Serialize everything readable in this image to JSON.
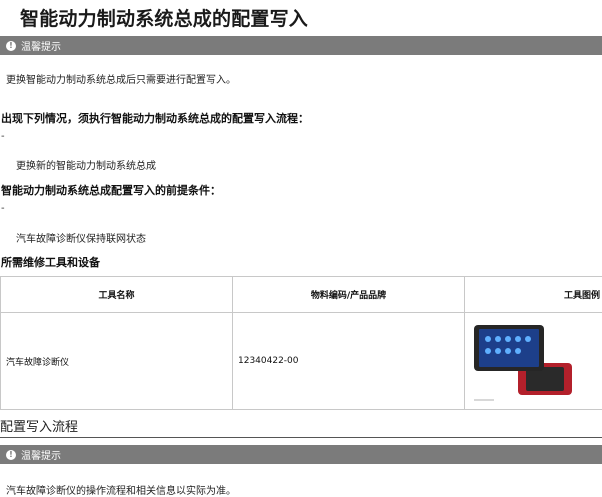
{
  "page": {
    "title": "智能动力制动系统总成的配置写入"
  },
  "notice_top": {
    "icon": "info-icon",
    "label": "温馨提示",
    "text": "更换智能动力制动系统总成后只需要进行配置写入。"
  },
  "conditions": {
    "heading": "出现下列情况，须执行智能动力制动系统总成的配置写入流程：",
    "bullet": "-",
    "item": "更换新的智能动力制动系统总成"
  },
  "prerequisites": {
    "heading": "智能动力制动系统总成配置写入的前提条件：",
    "bullet": "-",
    "item": "汽车故障诊断仪保持联网状态"
  },
  "tools": {
    "heading": "所需维修工具和设备",
    "columns": [
      "工具名称",
      "物料编码/产品品牌",
      "工具图例"
    ],
    "rows": [
      {
        "name": "汽车故障诊断仪",
        "code": "12340422-00",
        "image": "diagnostic-tablet-image"
      }
    ]
  },
  "procedure": {
    "title": "配置写入流程"
  },
  "notice_bottom": {
    "icon": "info-icon",
    "label": "温馨提示",
    "text": "汽车故障诊断仪的操作流程和相关信息以实际为准。"
  },
  "colors": {
    "notice_bar": "#7b7b7b",
    "border": "#c8c8c8",
    "device_red": "#b3202b",
    "device_screen": "#1d3f8a"
  }
}
